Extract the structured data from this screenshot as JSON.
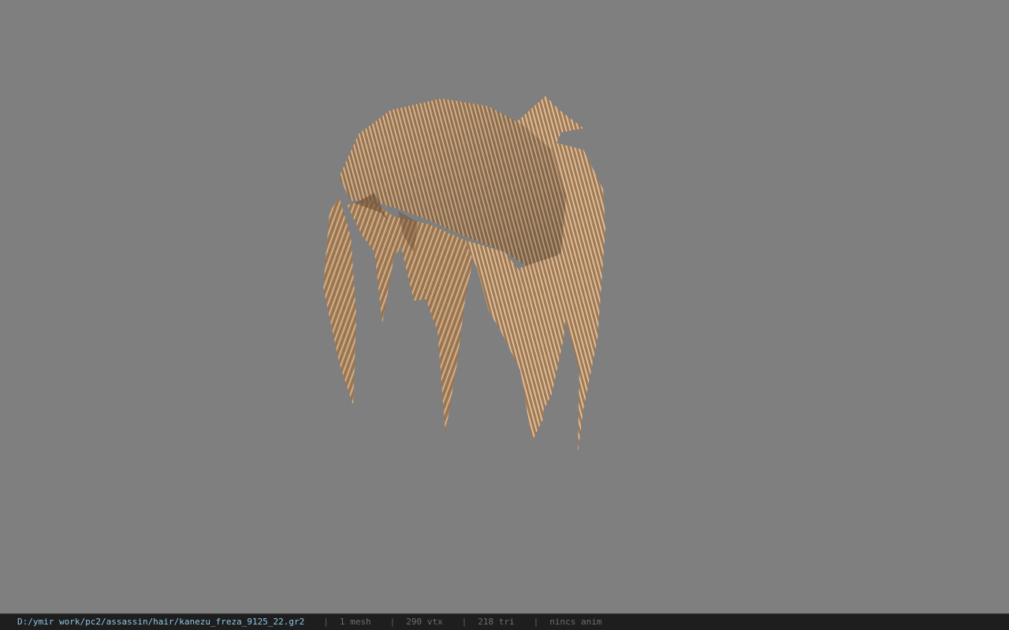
{
  "viewport": {
    "background_color": "#7f7f7f",
    "model_name": "hair-model",
    "hair_base_color": "#a8825c",
    "hair_highlight_color": "#e8cfae",
    "hair_shadow_color": "#6e4f32"
  },
  "status": {
    "file_path": "D:/ymir work/pc2/assassin/hair/kanezu_freza_9125_22.gr2",
    "separator": "|",
    "mesh_count": "1 mesh",
    "vertex_count": "290 vtx",
    "triangle_count": "218 tri",
    "anim_status": "nincs anim"
  }
}
